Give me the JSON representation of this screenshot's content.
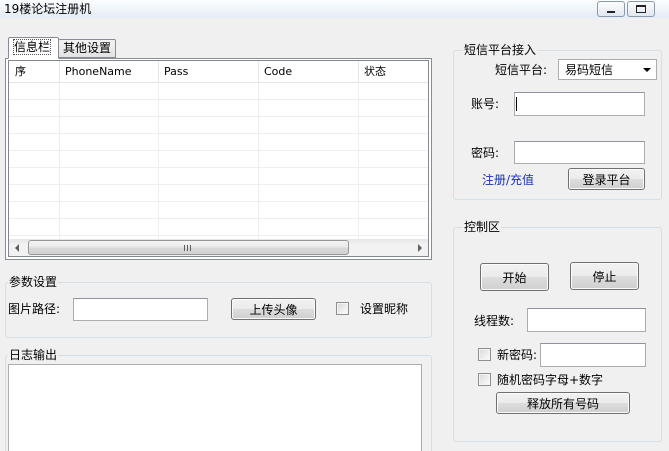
{
  "window": {
    "title": "19楼论坛注册机"
  },
  "tabs": [
    {
      "label": "信息栏",
      "selected": true
    },
    {
      "label": "其他设置",
      "selected": false
    }
  ],
  "list": {
    "columns": [
      "序",
      "PhoneName",
      "Pass",
      "Code",
      "状态"
    ],
    "rows": []
  },
  "params": {
    "title": "参数设置",
    "image_path_label": "图片路径:",
    "image_path_value": "",
    "upload_button": "上传头像",
    "nickname_label": "设置昵称",
    "nickname_checked": false
  },
  "log": {
    "title": "日志输出",
    "content": ""
  },
  "sms": {
    "title": "短信平台接入",
    "platform_label": "短信平台:",
    "platform_value": "易码短信",
    "account_label": "账号:",
    "account_value": "",
    "password_label": "密码:",
    "password_value": "",
    "register_link": "注册/充值",
    "login_button": "登录平台"
  },
  "control": {
    "title": "控制区",
    "start_button": "开始",
    "stop_button": "停止",
    "threads_label": "线程数:",
    "threads_value": "",
    "new_password_checked": false,
    "new_password_label": "新密码:",
    "new_password_value": "",
    "random_password_checked": false,
    "random_password_label": "随机密码字母+数字",
    "release_button": "释放所有号码"
  },
  "theme": {
    "link_color": "#1a33a8"
  }
}
